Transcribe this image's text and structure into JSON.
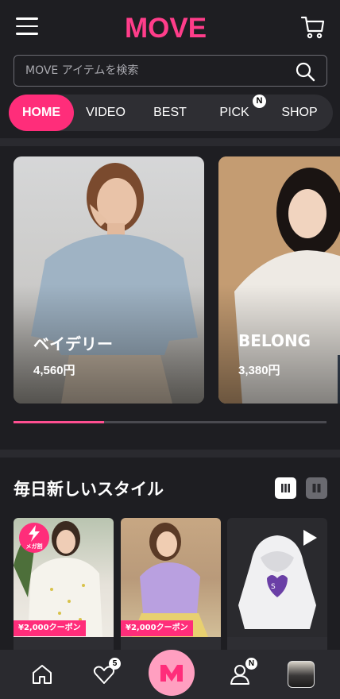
{
  "header": {
    "logo": "MOVE"
  },
  "search": {
    "placeholder": "MOVE アイテムを検索"
  },
  "nav": {
    "tabs": [
      {
        "label": "HOME",
        "active": true
      },
      {
        "label": "VIDEO",
        "active": false
      },
      {
        "label": "BEST",
        "active": false
      },
      {
        "label": "PICK",
        "active": false,
        "badge": "N"
      },
      {
        "label": "SHOP",
        "active": false
      }
    ]
  },
  "carousel": {
    "cards": [
      {
        "brand": "ベイデリー",
        "price": "4,560円"
      },
      {
        "brand": "BELONG",
        "price": "3,380円"
      }
    ],
    "progress": 0.29
  },
  "section": {
    "title": "毎日新しいスタイル"
  },
  "products": [
    {
      "coupon": "¥2,000クーポン",
      "mega_label": "メガ割",
      "has_mega": true
    },
    {
      "coupon": "¥2,000クーポン",
      "has_mega": false
    },
    {
      "video": true
    }
  ],
  "bottom_nav": {
    "like_count": "5",
    "my_badge": "N"
  },
  "colors": {
    "accent": "#ff2d7a",
    "background": "#1e1e22"
  }
}
